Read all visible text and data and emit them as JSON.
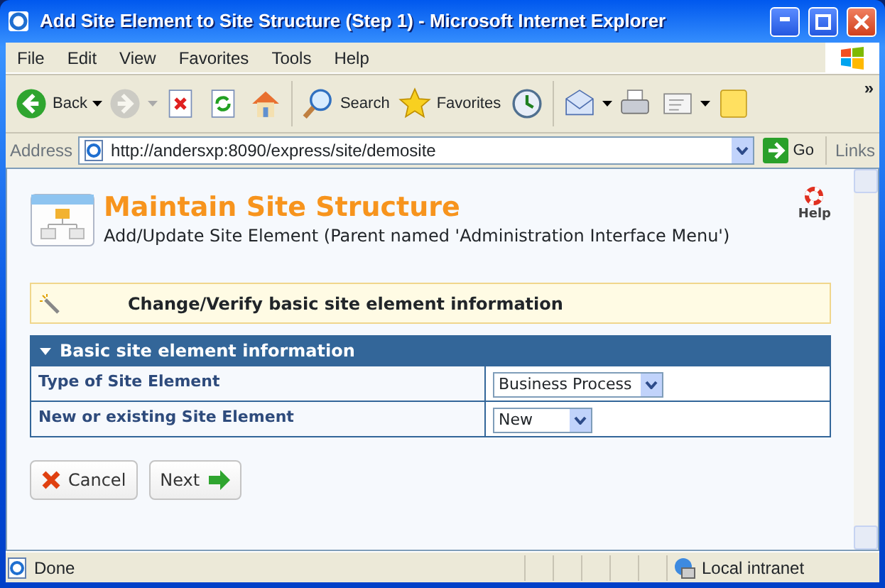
{
  "window": {
    "title": "Add Site Element to Site Structure (Step 1) - Microsoft Internet Explorer"
  },
  "menu": [
    "File",
    "Edit",
    "View",
    "Favorites",
    "Tools",
    "Help"
  ],
  "toolbar": [
    {
      "kind": "back",
      "label": "Back",
      "disabled": false
    },
    {
      "kind": "forward",
      "disabled": true
    },
    {
      "kind": "stop",
      "disabled": false
    },
    {
      "kind": "refresh",
      "disabled": false
    },
    {
      "kind": "home",
      "disabled": false
    },
    {
      "kind": "search",
      "label": "Search",
      "disabled": false
    },
    {
      "kind": "favorites",
      "label": "Favorites",
      "disabled": false
    },
    {
      "kind": "history",
      "disabled": false
    },
    {
      "kind": "mail",
      "disabled": false
    },
    {
      "kind": "print",
      "disabled": false
    },
    {
      "kind": "edit",
      "disabled": false
    },
    {
      "kind": "note",
      "disabled": false
    }
  ],
  "more": "»",
  "address": {
    "label": "Address",
    "value": "http://andersxp:8090/express/site/demosite",
    "go": "Go",
    "links": "Links"
  },
  "page": {
    "title": "Maintain Site Structure",
    "subtitle": "Add/Update Site Element (Parent named 'Administration Interface Menu')",
    "help": "Help",
    "banner": "Change/Verify basic site element information",
    "section": {
      "title": "Basic site element information",
      "expanded": true,
      "rows": [
        {
          "label": "Type of Site Element",
          "value": "Business Process"
        },
        {
          "label": "New or existing Site Element",
          "value": "New"
        }
      ]
    },
    "buttons": [
      {
        "kind": "cancel",
        "label": "Cancel"
      },
      {
        "kind": "next",
        "label": "Next"
      }
    ]
  },
  "status_bar": {
    "text": "Done",
    "zone": "Local intranet"
  }
}
